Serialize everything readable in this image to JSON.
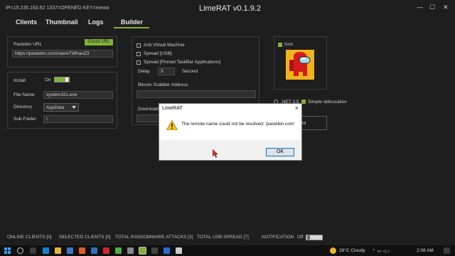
{
  "window": {
    "info": "IP=15.235.163.92   1337=OPENED  KEY=meow",
    "title": "LimeRAT v0.1.9.2",
    "minimize": "—",
    "maximize": "☐",
    "close": "✕"
  },
  "tabs": [
    "Clients",
    "Thumbnail",
    "Logs",
    "Builder"
  ],
  "active_tab": "Builder",
  "accent_color": "#7fb13b",
  "pastebin": {
    "label": "Pastebin URL",
    "check_button": "Check URL",
    "value": "https://pastebin.com/raw/eTWhanZ3"
  },
  "install": {
    "install_label": "Install",
    "toggle_state": "On",
    "file_name_label": "File Name",
    "file_name_value": "system32s.exe",
    "directory_label": "Directory",
    "directory_value": "AppData",
    "sub_folder_label": "Sub Folder",
    "sub_folder_value": "\\"
  },
  "options": {
    "anti_vm": "Anti Virtual Machine",
    "spread_usb": "Spread [USB]",
    "spread_pinned": "Spread [Pinned TaskBar Applications]",
    "delay_label": "Delay",
    "delay_value": "3",
    "delay_unit": "Second",
    "bitcoin_label": "Bitcoin Grabber Address",
    "download_label": "Download"
  },
  "icon_panel": {
    "icon_label": "Icon",
    "net_label": ".NET 3.5",
    "obfuscation_label": "Simple obfuscation",
    "build_stub": "ld"
  },
  "dialog": {
    "title": "LimeRAT",
    "message": "The remote name could not be resolved: 'pastebin.com'",
    "ok": "OK"
  },
  "statusbar": {
    "online": "ONLINE CLIENTS [0]",
    "selected": "SELECTED CLIENTS [0]",
    "ransomware": "TOTAL RANSOMWARE ATTACKS [3]",
    "usb": "TOTAL USB SPREAD [7]",
    "notification": "NOTIFICATION",
    "notification_state": "Off"
  },
  "taskbar": {
    "weather": "26°C  Cloudy",
    "time": "2:08 AM"
  }
}
